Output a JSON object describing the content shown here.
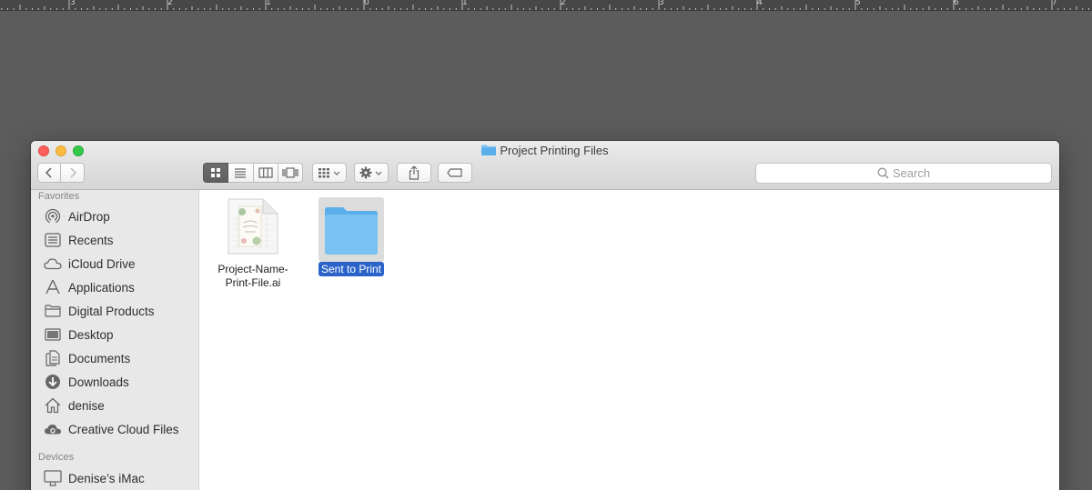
{
  "ruler": {
    "labels": [
      "3",
      "2",
      "1",
      "0",
      "1",
      "2",
      "3",
      "4",
      "5",
      "6",
      "7"
    ]
  },
  "window": {
    "title": "Project Printing Files",
    "search_placeholder": "Search"
  },
  "sidebar": {
    "favorites_title": "Favorites",
    "favorites": [
      {
        "label": "AirDrop",
        "icon": "airdrop-icon"
      },
      {
        "label": "Recents",
        "icon": "recents-icon"
      },
      {
        "label": "iCloud Drive",
        "icon": "icloud-icon"
      },
      {
        "label": "Applications",
        "icon": "applications-icon"
      },
      {
        "label": "Digital Products",
        "icon": "folder-icon"
      },
      {
        "label": "Desktop",
        "icon": "desktop-icon"
      },
      {
        "label": "Documents",
        "icon": "documents-icon"
      },
      {
        "label": "Downloads",
        "icon": "downloads-icon"
      },
      {
        "label": "denise",
        "icon": "home-icon"
      },
      {
        "label": "Creative Cloud Files",
        "icon": "creative-cloud-icon"
      }
    ],
    "devices_title": "Devices",
    "devices": [
      {
        "label": "Denise’s iMac",
        "icon": "imac-icon"
      }
    ]
  },
  "files": [
    {
      "name_line1": "Project-Name-",
      "name_line2": "Print-File.ai",
      "icon": "ai-file-icon",
      "selected": false
    },
    {
      "name": "Sent to Print",
      "icon": "folder-icon",
      "selected": true
    }
  ],
  "colors": {
    "selection": "#2b63c9",
    "folder": "#6cb8ef"
  }
}
